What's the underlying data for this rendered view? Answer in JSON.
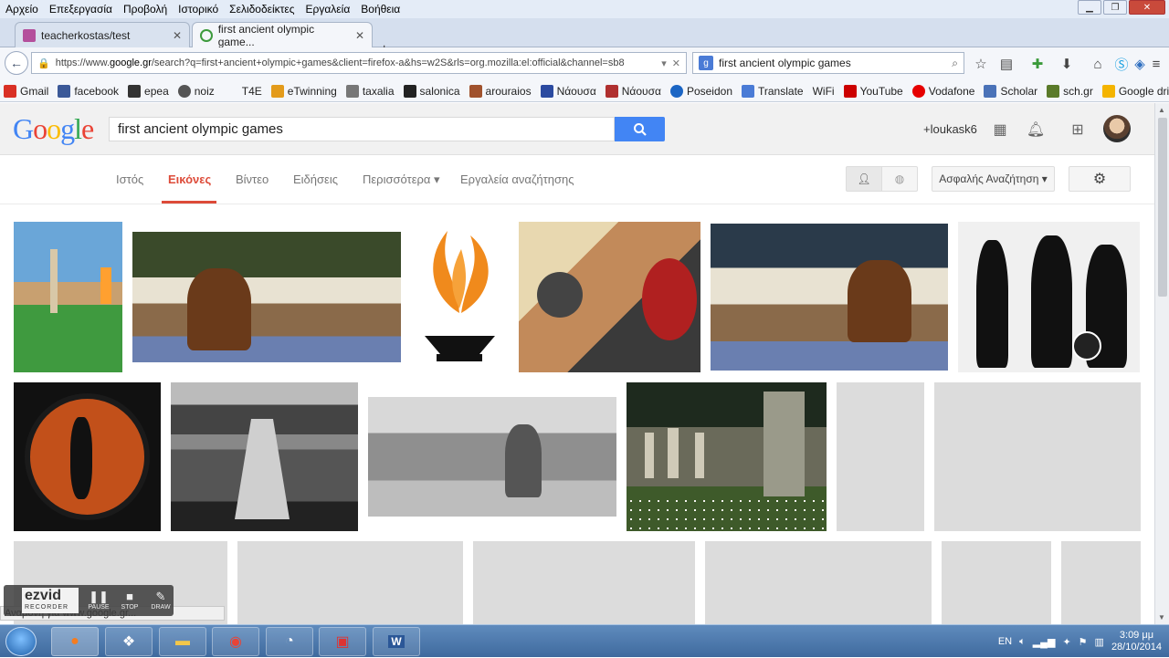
{
  "menu": [
    "Αρχείο",
    "Επεξεργασία",
    "Προβολή",
    "Ιστορικό",
    "Σελιδοδείκτες",
    "Εργαλεία",
    "Βοήθεια"
  ],
  "tabs": [
    {
      "label": "teacherkostas/test",
      "color": "#b44f9c"
    },
    {
      "label": "first ancient olympic game...",
      "color": "#3d9a3d"
    }
  ],
  "url": {
    "prefix": "https://www.",
    "domain": "google.gr",
    "path": "/search?q=first+ancient+olympic+games&client=firefox-a&hs=w2S&rls=org.mozilla:el:official&channel=sb8"
  },
  "search_box": {
    "value": "first ancient olympic games"
  },
  "bookmarks": [
    {
      "label": "Gmail",
      "color": "#d93025"
    },
    {
      "label": "facebook",
      "color": "#3b5998"
    },
    {
      "label": "epea",
      "color": "#333"
    },
    {
      "label": "noiz",
      "color": "#555"
    },
    {
      "label": "T4E",
      "color": ""
    },
    {
      "label": "eTwinning",
      "color": "#e39b1b"
    },
    {
      "label": "taxalia",
      "color": "#777"
    },
    {
      "label": "salonica",
      "color": "#222"
    },
    {
      "label": "arouraios",
      "color": "#a0522d"
    },
    {
      "label": "Νάουσα",
      "color": "#2b4aa0"
    },
    {
      "label": "Νάουσα",
      "color": "#b03030"
    },
    {
      "label": "Poseidon",
      "color": "#1b65c4"
    },
    {
      "label": "Translate",
      "color": "#4a7bd6"
    },
    {
      "label": "WiFi",
      "color": ""
    },
    {
      "label": "YouTube",
      "color": "#cc0000"
    },
    {
      "label": "Vodafone",
      "color": "#e60000"
    },
    {
      "label": "Scholar",
      "color": "#4a72b8"
    },
    {
      "label": "sch.gr",
      "color": "#5a7a2a"
    },
    {
      "label": "Google drive",
      "color": "#f4b400"
    }
  ],
  "google": {
    "logo": "Google",
    "query": "first ancient olympic games",
    "user": "+loukask6",
    "tabs": [
      "Ιστός",
      "Εικόνες",
      "Βίντεο",
      "Ειδήσεις",
      "Περισσότερα ▾",
      "Εργαλεία αναζήτησης"
    ],
    "safe_search": "Ασφαλής Αναζήτηση ▾"
  },
  "ezvid": {
    "logo": "ezvid",
    "sub": "RECORDER",
    "pause": "PAUSE",
    "stop": "STOP",
    "draw": "DRAW"
  },
  "status_text": "Αναμονή για www.google.gr...",
  "tray": {
    "lang": "EN",
    "time": "3:09 μμ",
    "date": "28/10/2014"
  },
  "colors": {
    "accent_red": "#dd4b39",
    "google_blue": "#4285f4"
  }
}
